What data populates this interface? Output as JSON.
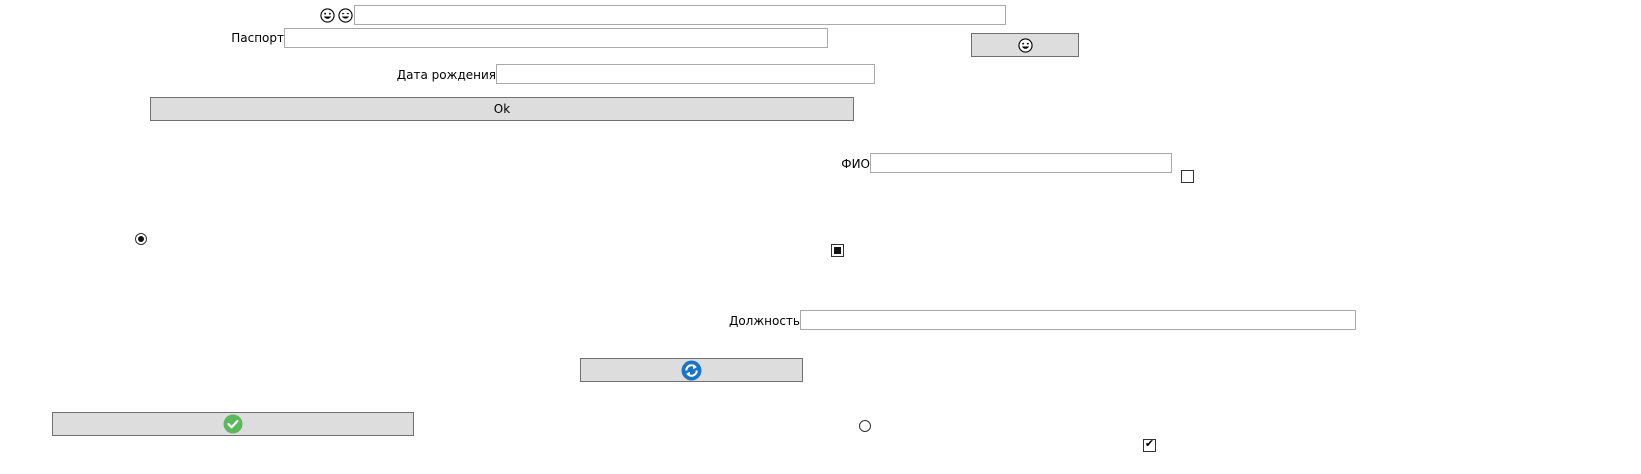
{
  "form": {
    "passport_label": "Паспорт",
    "birthdate_label": "Дата рождения",
    "ok_button_label": "Ok",
    "fio_label": "ФИО",
    "position_label": "Должность",
    "emoji_field": {
      "value": "",
      "placeholder": ""
    },
    "passport_field": {
      "value": "",
      "placeholder": ""
    },
    "birthdate_field": {
      "value": "",
      "placeholder": ""
    },
    "fio_field": {
      "value": "",
      "placeholder": ""
    },
    "position_field": {
      "value": "",
      "placeholder": ""
    }
  },
  "controls": {
    "fio_checkbox_checked": false,
    "indeterminate_checkbox_state": "indeterminate",
    "bottom_checkbox_checked": true,
    "left_radio_selected": true,
    "bottom_radio_selected": false
  },
  "icons": {
    "top_left_emojis": [
      "grinning-face-icon",
      "smiling-face-icon"
    ],
    "emoji_button_icon": "grinning-face-icon",
    "blue_button_icon": "sync-icon",
    "green_button_icon": "check-circle-icon"
  },
  "colors": {
    "button_bg": "#dddddd",
    "button_border": "#707070",
    "field_border": "#a9a9a9",
    "blue_icon": "#1a73c8",
    "green_icon": "#5cb85c"
  }
}
